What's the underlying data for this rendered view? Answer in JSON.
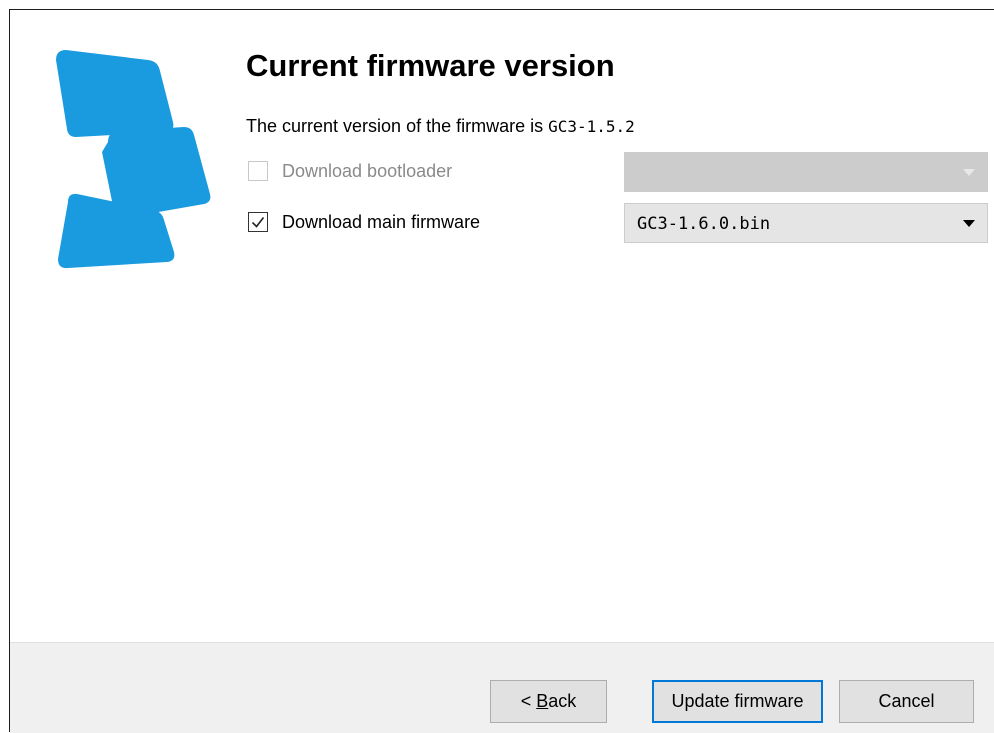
{
  "wizard": {
    "title": "Current firmware version",
    "info_prefix": "The current version of the firmware is ",
    "info_version": "GC3-1.5.2"
  },
  "options": [
    {
      "label": "Download bootloader",
      "checked": false,
      "enabled": false,
      "selected": ""
    },
    {
      "label": "Download main firmware",
      "checked": true,
      "enabled": true,
      "selected": "GC3-1.6.0.bin"
    }
  ],
  "footer": {
    "back_prefix": "< ",
    "back_mnemonic": "B",
    "back_rest": "ack",
    "update_label": "Update firmware",
    "cancel_label": "Cancel"
  },
  "colors": {
    "logo": "#1a9be0",
    "focus_border": "#0078d7",
    "footer_bg": "#f0f0f0"
  },
  "icons": {
    "logo": "logo-icon",
    "check": "checkmark-icon",
    "dropdown": "chevron-down-icon"
  }
}
